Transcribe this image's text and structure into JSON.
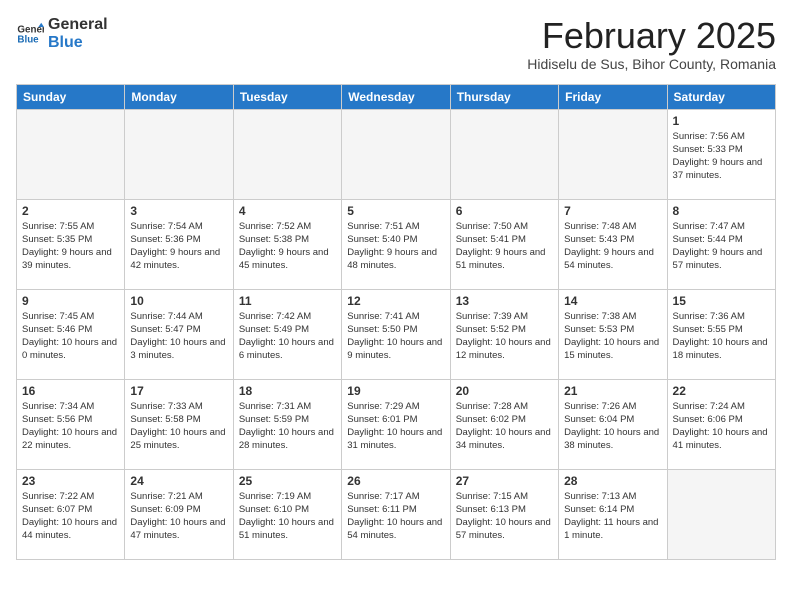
{
  "header": {
    "logo_line1": "General",
    "logo_line2": "Blue",
    "month_title": "February 2025",
    "location": "Hidiselu de Sus, Bihor County, Romania"
  },
  "days_of_week": [
    "Sunday",
    "Monday",
    "Tuesday",
    "Wednesday",
    "Thursday",
    "Friday",
    "Saturday"
  ],
  "weeks": [
    [
      {
        "day": "",
        "info": ""
      },
      {
        "day": "",
        "info": ""
      },
      {
        "day": "",
        "info": ""
      },
      {
        "day": "",
        "info": ""
      },
      {
        "day": "",
        "info": ""
      },
      {
        "day": "",
        "info": ""
      },
      {
        "day": "1",
        "info": "Sunrise: 7:56 AM\nSunset: 5:33 PM\nDaylight: 9 hours and 37 minutes."
      }
    ],
    [
      {
        "day": "2",
        "info": "Sunrise: 7:55 AM\nSunset: 5:35 PM\nDaylight: 9 hours and 39 minutes."
      },
      {
        "day": "3",
        "info": "Sunrise: 7:54 AM\nSunset: 5:36 PM\nDaylight: 9 hours and 42 minutes."
      },
      {
        "day": "4",
        "info": "Sunrise: 7:52 AM\nSunset: 5:38 PM\nDaylight: 9 hours and 45 minutes."
      },
      {
        "day": "5",
        "info": "Sunrise: 7:51 AM\nSunset: 5:40 PM\nDaylight: 9 hours and 48 minutes."
      },
      {
        "day": "6",
        "info": "Sunrise: 7:50 AM\nSunset: 5:41 PM\nDaylight: 9 hours and 51 minutes."
      },
      {
        "day": "7",
        "info": "Sunrise: 7:48 AM\nSunset: 5:43 PM\nDaylight: 9 hours and 54 minutes."
      },
      {
        "day": "8",
        "info": "Sunrise: 7:47 AM\nSunset: 5:44 PM\nDaylight: 9 hours and 57 minutes."
      }
    ],
    [
      {
        "day": "9",
        "info": "Sunrise: 7:45 AM\nSunset: 5:46 PM\nDaylight: 10 hours and 0 minutes."
      },
      {
        "day": "10",
        "info": "Sunrise: 7:44 AM\nSunset: 5:47 PM\nDaylight: 10 hours and 3 minutes."
      },
      {
        "day": "11",
        "info": "Sunrise: 7:42 AM\nSunset: 5:49 PM\nDaylight: 10 hours and 6 minutes."
      },
      {
        "day": "12",
        "info": "Sunrise: 7:41 AM\nSunset: 5:50 PM\nDaylight: 10 hours and 9 minutes."
      },
      {
        "day": "13",
        "info": "Sunrise: 7:39 AM\nSunset: 5:52 PM\nDaylight: 10 hours and 12 minutes."
      },
      {
        "day": "14",
        "info": "Sunrise: 7:38 AM\nSunset: 5:53 PM\nDaylight: 10 hours and 15 minutes."
      },
      {
        "day": "15",
        "info": "Sunrise: 7:36 AM\nSunset: 5:55 PM\nDaylight: 10 hours and 18 minutes."
      }
    ],
    [
      {
        "day": "16",
        "info": "Sunrise: 7:34 AM\nSunset: 5:56 PM\nDaylight: 10 hours and 22 minutes."
      },
      {
        "day": "17",
        "info": "Sunrise: 7:33 AM\nSunset: 5:58 PM\nDaylight: 10 hours and 25 minutes."
      },
      {
        "day": "18",
        "info": "Sunrise: 7:31 AM\nSunset: 5:59 PM\nDaylight: 10 hours and 28 minutes."
      },
      {
        "day": "19",
        "info": "Sunrise: 7:29 AM\nSunset: 6:01 PM\nDaylight: 10 hours and 31 minutes."
      },
      {
        "day": "20",
        "info": "Sunrise: 7:28 AM\nSunset: 6:02 PM\nDaylight: 10 hours and 34 minutes."
      },
      {
        "day": "21",
        "info": "Sunrise: 7:26 AM\nSunset: 6:04 PM\nDaylight: 10 hours and 38 minutes."
      },
      {
        "day": "22",
        "info": "Sunrise: 7:24 AM\nSunset: 6:06 PM\nDaylight: 10 hours and 41 minutes."
      }
    ],
    [
      {
        "day": "23",
        "info": "Sunrise: 7:22 AM\nSunset: 6:07 PM\nDaylight: 10 hours and 44 minutes."
      },
      {
        "day": "24",
        "info": "Sunrise: 7:21 AM\nSunset: 6:09 PM\nDaylight: 10 hours and 47 minutes."
      },
      {
        "day": "25",
        "info": "Sunrise: 7:19 AM\nSunset: 6:10 PM\nDaylight: 10 hours and 51 minutes."
      },
      {
        "day": "26",
        "info": "Sunrise: 7:17 AM\nSunset: 6:11 PM\nDaylight: 10 hours and 54 minutes."
      },
      {
        "day": "27",
        "info": "Sunrise: 7:15 AM\nSunset: 6:13 PM\nDaylight: 10 hours and 57 minutes."
      },
      {
        "day": "28",
        "info": "Sunrise: 7:13 AM\nSunset: 6:14 PM\nDaylight: 11 hours and 1 minute."
      },
      {
        "day": "",
        "info": ""
      }
    ]
  ]
}
